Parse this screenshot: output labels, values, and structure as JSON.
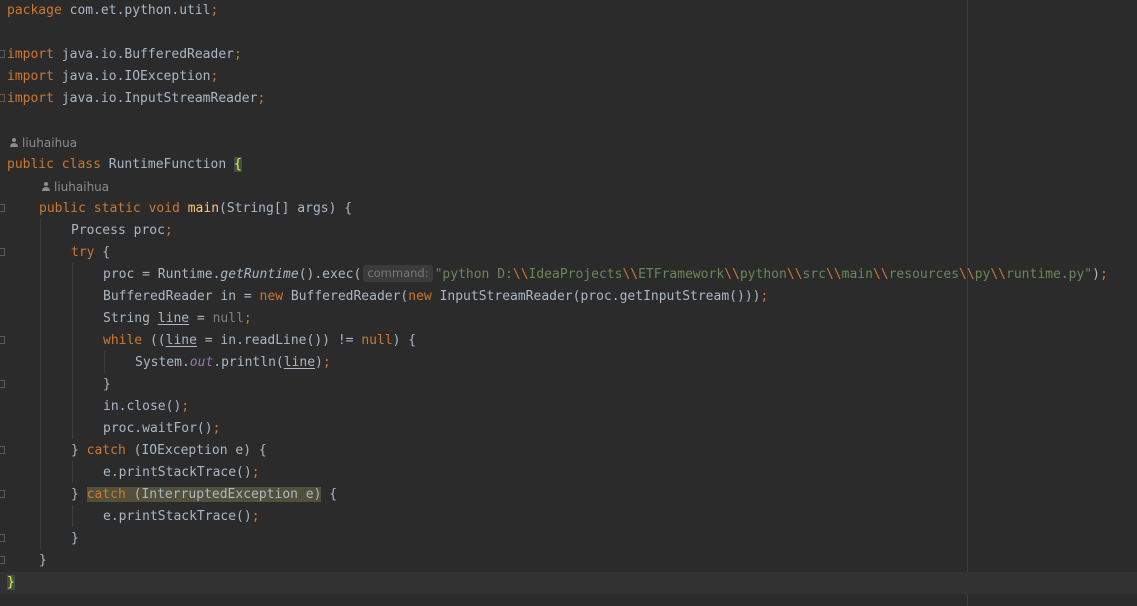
{
  "editor": {
    "package_line": {
      "kw": "package",
      "name": " com.et.python.util",
      "semi": ";"
    },
    "imports": [
      {
        "kw": "import",
        "name": " java.io.BufferedReader",
        "semi": ";"
      },
      {
        "kw": "import",
        "name": " java.io.IOException",
        "semi": ";"
      },
      {
        "kw": "import",
        "name": " java.io.InputStreamReader",
        "semi": ";"
      }
    ],
    "class_author": "liuhaihua",
    "method_author": "liuhaihua",
    "class_decl": {
      "kw": "public class",
      "name": " RuntimeFunction ",
      "brace": "{"
    },
    "method_decl": {
      "kw": "public static void",
      "sp": " ",
      "name": "main",
      "params": "(String[] args) {"
    },
    "lines": {
      "process_decl": {
        "text": "Process proc",
        "semi": ";"
      },
      "try_open": {
        "kw": "try",
        "rest": " {"
      },
      "exec_prefix": "proc = Runtime.",
      "exec_method": "getRuntime",
      "exec_mid": "().exec(",
      "exec_hint": "command:",
      "exec_str_parts": [
        "\"python D:",
        "\\\\",
        "IdeaProjects",
        "\\\\",
        "ETFramework",
        "\\\\",
        "python",
        "\\\\",
        "src",
        "\\\\",
        "main",
        "\\\\",
        "resources",
        "\\\\",
        "py",
        "\\\\",
        "runtime.py\""
      ],
      "exec_end": ")",
      "exec_semi": ";",
      "reader_a": "BufferedReader in = ",
      "reader_new1": "new",
      "reader_b": " BufferedReader(",
      "reader_new2": "new",
      "reader_c": " InputStreamReader(proc.getInputStream()))",
      "reader_semi": ";",
      "string_a": "String ",
      "string_var": "line",
      "string_b": " = ",
      "string_null": "null",
      "string_semi": ";",
      "while_kw": "while",
      "while_a": " ((",
      "while_var": "line",
      "while_b": " = in.readLine()) != ",
      "while_null": "null",
      "while_c": ") {",
      "print_a": "System.",
      "print_out": "out",
      "print_b": ".println(",
      "print_var": "line",
      "print_c": ")",
      "print_semi": ";",
      "while_close": "}",
      "close_call": "in.close()",
      "close_semi": ";",
      "wait_call": "proc.waitFor()",
      "wait_semi": ";",
      "catch1_a": "} ",
      "catch1_kw": "catch",
      "catch1_b": " (IOException e) {",
      "trace1": "e.printStackTrace()",
      "trace1_semi": ";",
      "catch2_a": "} ",
      "catch2_kw": "catch",
      "catch2_b": " (InterruptedException e)",
      "catch2_c": " {",
      "trace2": "e.printStackTrace()",
      "trace2_semi": ";",
      "try_close": "}",
      "method_close": "}",
      "class_close": "}"
    }
  }
}
